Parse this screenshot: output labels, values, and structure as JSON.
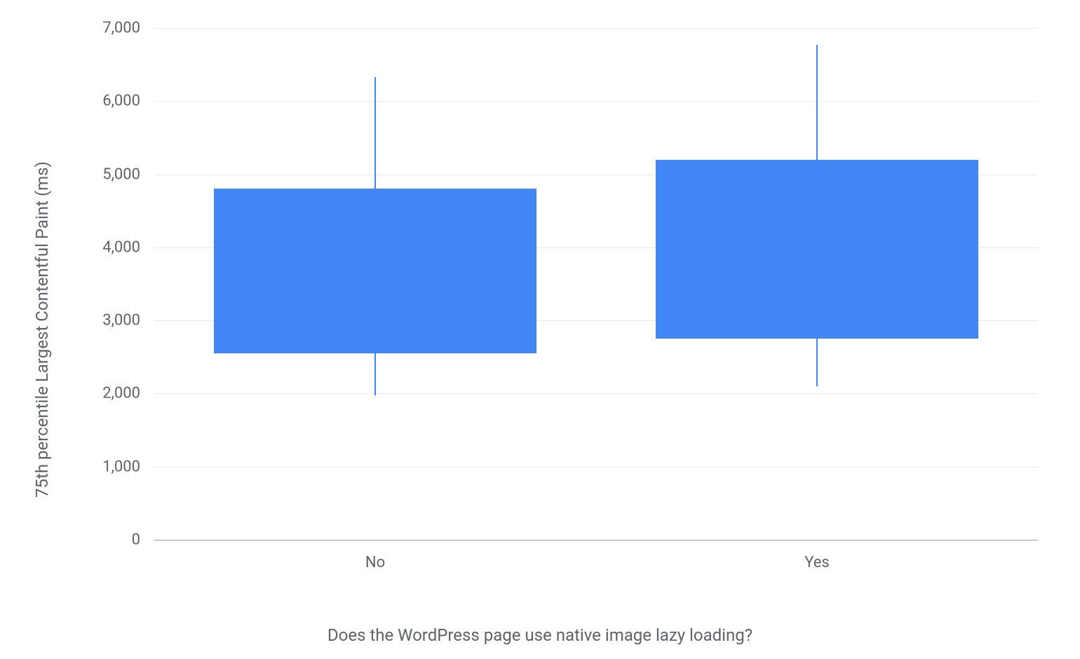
{
  "chart_data": {
    "type": "boxplot",
    "xlabel": "Does the WordPress page use native image lazy loading?",
    "ylabel": "75th percentile Largest Contentful Paint (ms)",
    "ylim": [
      0,
      7000
    ],
    "y_ticks": [
      0,
      1000,
      2000,
      3000,
      4000,
      5000,
      6000,
      7000
    ],
    "y_tick_labels": [
      "0",
      "1,000",
      "2,000",
      "3,000",
      "4,000",
      "5,000",
      "6,000",
      "7,000"
    ],
    "categories": [
      "No",
      "Yes"
    ],
    "series": [
      {
        "name": "No",
        "whisker_low": 1980,
        "q1": 2550,
        "q3": 4800,
        "whisker_high": 6330
      },
      {
        "name": "Yes",
        "whisker_low": 2100,
        "q1": 2750,
        "q3": 5200,
        "whisker_high": 6770
      }
    ],
    "colors": {
      "box": "#4285f4",
      "whisker": "#4285f4",
      "grid": "#e8eaed",
      "axis": "#9aa0a6",
      "text": "#5f6368"
    }
  }
}
